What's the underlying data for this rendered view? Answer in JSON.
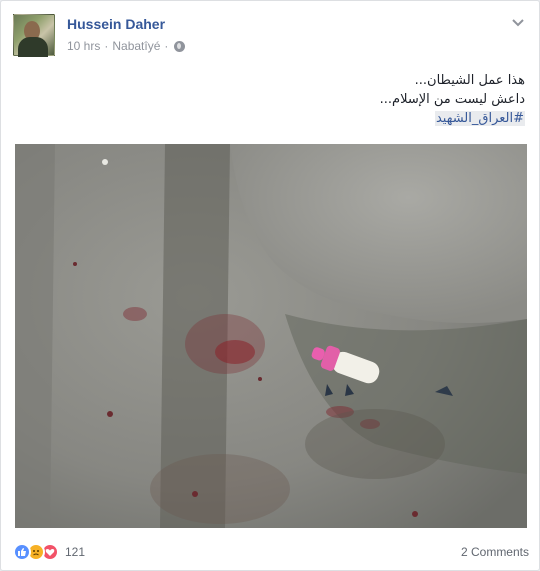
{
  "post": {
    "author": "Hussein Daher",
    "time": "10 hrs",
    "separator": "·",
    "location": "Nabatîyé",
    "separator2": "·",
    "privacy_icon": "globe-icon",
    "text_line1": "هذا عمل الشيطان...",
    "text_line2": "داعش ليست من الإسلام...",
    "hashtag": "#العراق_الشهيد"
  },
  "footer": {
    "reaction_icons": [
      "like-icon",
      "sad-icon",
      "love-icon"
    ],
    "reaction_count": "121",
    "comments": "2 Comments"
  },
  "colors": {
    "link": "#365899",
    "meta": "#90949c",
    "like": "#5890ff",
    "sad": "#f7b125",
    "love": "#f25268"
  }
}
